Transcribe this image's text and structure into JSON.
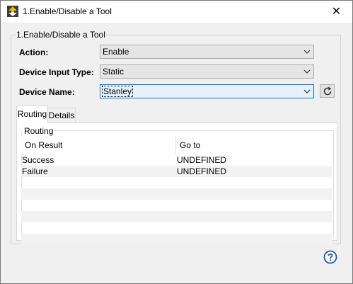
{
  "window": {
    "title": "1.Enable/Disable a Tool",
    "close_glyph": "✕"
  },
  "group": {
    "legend": "1.Enable/Disable a Tool"
  },
  "form": {
    "action": {
      "label": "Action:",
      "value": "Enable"
    },
    "device_input_type": {
      "label": "Device Input Type:",
      "value": "Static"
    },
    "device_name": {
      "label": "Device Name:",
      "value": "Stanley"
    }
  },
  "tabs": [
    {
      "label": "Routing",
      "active": true
    },
    {
      "label": "Details",
      "active": false
    }
  ],
  "routing": {
    "legend": "Routing",
    "columns": [
      "On Result",
      "Go to"
    ],
    "rows": [
      {
        "on_result": "Success",
        "go_to": "UNDEFINED"
      },
      {
        "on_result": "Failure",
        "go_to": "UNDEFINED"
      }
    ]
  },
  "icons": {
    "app": "app-icon",
    "close": "close-icon",
    "chevron": "chevron-down-icon",
    "refresh": "refresh-icon",
    "help": "help-icon"
  },
  "colors": {
    "accent": "#0078d7",
    "help_blue": "#1e5aa8"
  }
}
